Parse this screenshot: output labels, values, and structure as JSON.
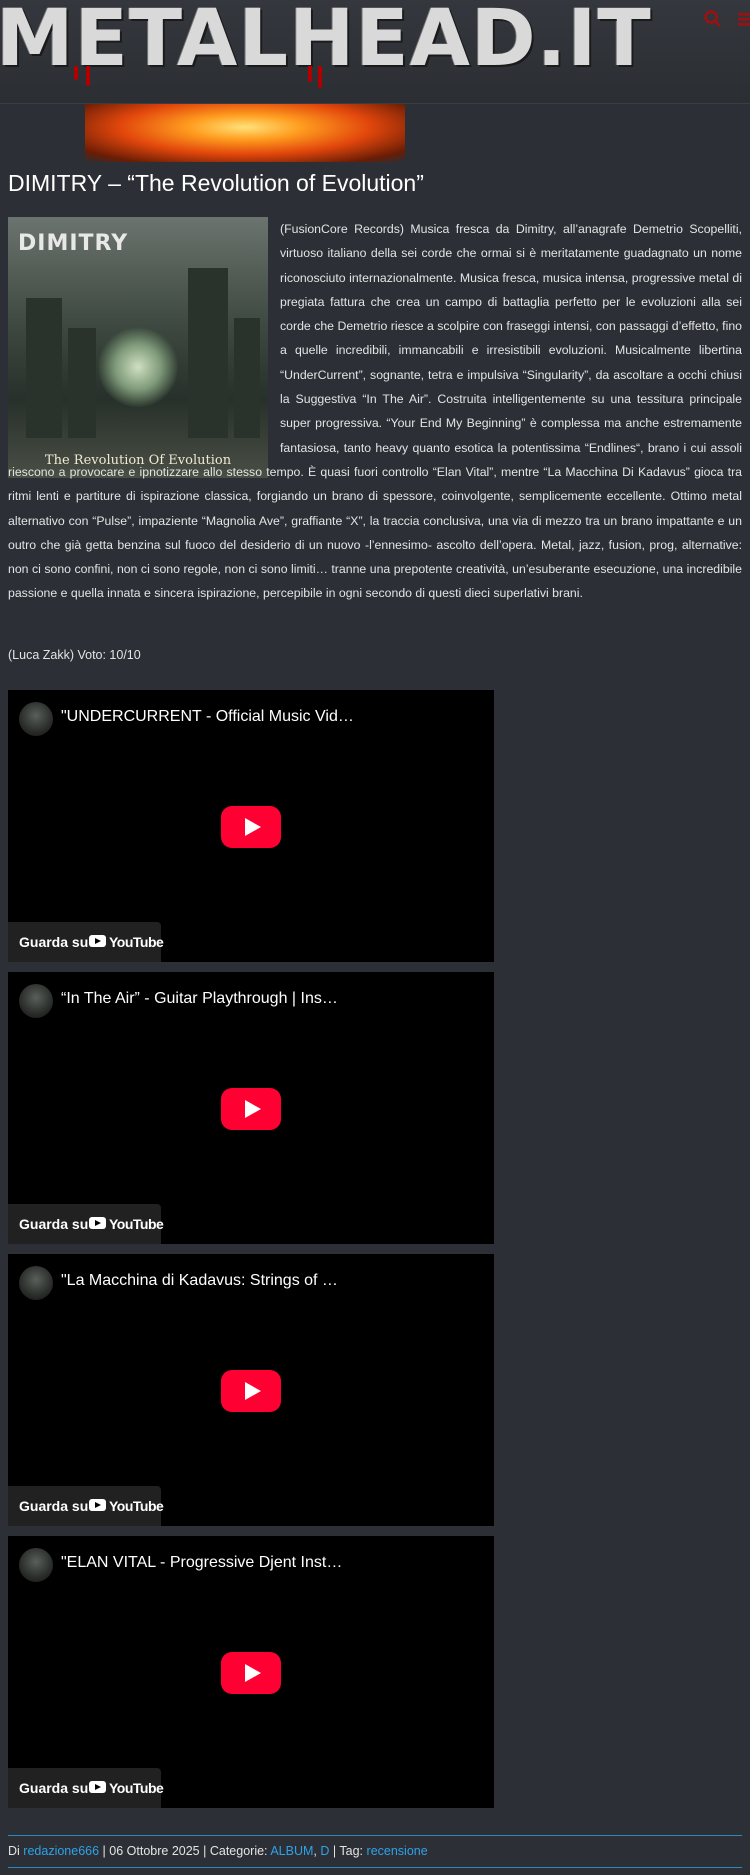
{
  "header": {
    "logo_text": "METALHEAD.IT",
    "search_icon": "search-icon",
    "menu_icon": "menu-icon",
    "accent_color": "#a10f0f"
  },
  "article": {
    "title": "DIMITRY – “The Revolution of Evolution”",
    "cover": {
      "band_text": "DIMITRY",
      "album_text": "The Revolution Of Evolution"
    },
    "body": "(FusionCore Records) Musica fresca da Dimitry, all’anagrafe Demetrio Scopelliti, virtuoso italiano della sei corde che ormai si è meritatamente guadagnato un nome riconosciuto internazionalmente. Musica fresca, musica intensa, progressive metal di pregiata fattura che crea un campo di battaglia perfetto per le evoluzioni alla sei corde che Demetrio riesce a scolpire con fraseggi intensi, con passaggi d’effetto, fino a quelle incredibili, immancabili e irresistibili evoluzioni. Musicalmente libertina “UnderCurrent”, sognante, tetra e impulsiva “Singularity”, da ascoltare a occhi chiusi la Suggestiva “In The Air”. Costruita intelligentemente su una tessitura principale super progressiva. “Your End My Beginning” è complessa ma anche estremamente fantasiosa, tanto heavy quanto esotica la potentissima “Endlines“, brano i cui assoli riescono a provocare e ipnotizzare allo stesso tempo. È quasi fuori controllo “Elan Vital”, mentre “La Macchina Di Kadavus” gioca tra ritmi lenti e partiture di ispirazione classica, forgiando un brano di spessore, coinvolgente, semplicemente eccellente. Ottimo metal alternativo con “Pulse”, impaziente “Magnolia Ave”, graffiante “X”, la traccia conclusiva, una via di mezzo tra un brano impattante e un outro che già getta benzina sul fuoco del desiderio di un nuovo -l’ennesimo- ascolto dell’opera. Metal, jazz, fusion, prog, alternative: non ci sono confini, non ci sono regole, non ci sono limiti… tranne una prepotente creatività, un’esuberante esecuzione, una incredibile passione e quella innata e sincera ispirazione, percepibile in ogni secondo di questi dieci superlativi brani.",
    "author_line": "(Luca Zakk) Voto: 10/10"
  },
  "videos": [
    {
      "title": "\"UNDERCURRENT - Official Music Vid…",
      "watch_label": "Guarda su",
      "platform": "YouTube"
    },
    {
      "title": "“In The Air” - Guitar Playthrough | Ins…",
      "watch_label": "Guarda su",
      "platform": "YouTube"
    },
    {
      "title": "\"La Macchina di Kadavus: Strings of …",
      "watch_label": "Guarda su",
      "platform": "YouTube"
    },
    {
      "title": "\"ELAN VITAL - Progressive Djent Inst…",
      "watch_label": "Guarda su",
      "platform": "YouTube"
    }
  ],
  "meta": {
    "by_label": "Di",
    "author": "redazione666",
    "sep1": "|",
    "date": "06 Ottobre 2025",
    "sep2": "|",
    "categories_label": "Categorie:",
    "category_1": "ALBUM",
    "comma": ",",
    "category_2": "D",
    "sep3": "|",
    "tags_label": "Tag:",
    "tag_1": "recensione",
    "link_color": "#2ea3e8"
  }
}
